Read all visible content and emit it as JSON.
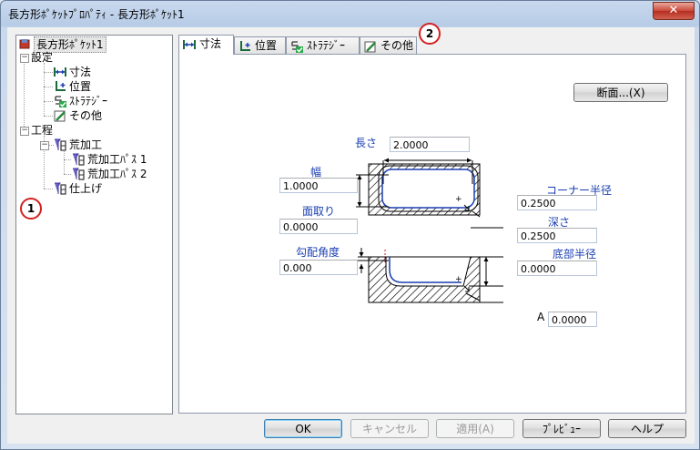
{
  "window": {
    "title": "長方形ﾎﾟｹｯﾄﾌﾟﾛﾊﾟﾃｨ - 長方形ﾎﾟｹｯﾄ1",
    "close_glyph": "✕"
  },
  "tree": {
    "root": "長方形ﾎﾟｹｯﾄ1",
    "settings_group": "設定",
    "settings_items": [
      "寸法",
      "位置",
      "ｽﾄﾗﾃｼﾞｰ",
      "その他"
    ],
    "process_group": "工程",
    "rough": "荒加工",
    "rough_passes": [
      "荒加工ﾊﾟｽ 1",
      "荒加工ﾊﾟｽ 2"
    ],
    "finish": "仕上げ"
  },
  "badges": {
    "tree": "1",
    "tabs": "2"
  },
  "tabs": [
    {
      "label": "寸法",
      "icon": "dimension-icon"
    },
    {
      "label": "位置",
      "icon": "position-icon"
    },
    {
      "label": "ｽﾄﾗﾃｼﾞｰ",
      "icon": "strategy-icon"
    },
    {
      "label": "その他",
      "icon": "other-icon"
    }
  ],
  "dimensions": {
    "section_button": "断面...(X)",
    "length_label": "長さ",
    "length_value": "2.0000",
    "width_label": "幅",
    "width_value": "1.0000",
    "chamfer_label": "面取り",
    "chamfer_value": "0.0000",
    "draft_label": "勾配角度",
    "draft_value": "0.000",
    "corner_label": "コーナー半径",
    "corner_value": "0.2500",
    "depth_label": "深さ",
    "depth_value": "0.2500",
    "bottom_label": "底部半径",
    "bottom_value": "0.0000",
    "a_label": "A",
    "a_value": "0.0000"
  },
  "buttons": {
    "ok": "OK",
    "cancel": "キャンセル",
    "apply": "適用(A)",
    "preview": "ﾌﾟﾚﾋﾞｭｰ",
    "help": "ヘルプ"
  },
  "colors": {
    "accent_blue": "#1a3fb0",
    "badge_red": "#d42020"
  }
}
